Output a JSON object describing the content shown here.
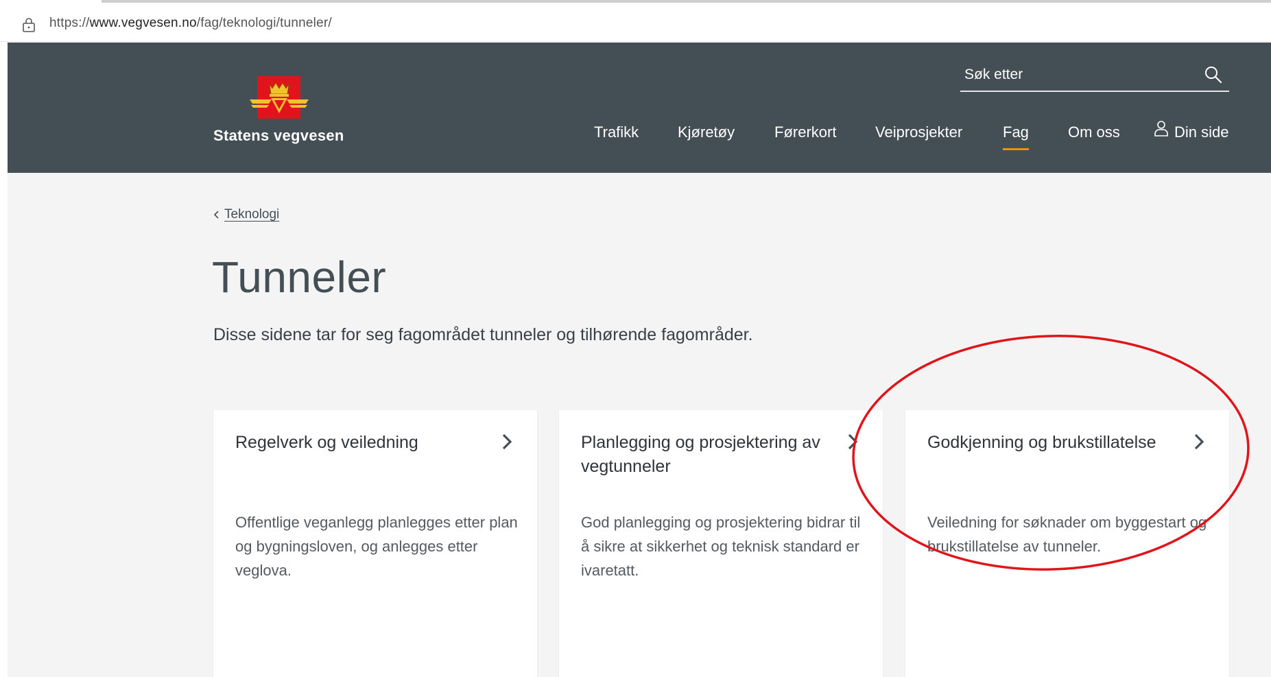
{
  "browser": {
    "url_scheme": "https://",
    "url_host": "www.vegvesen.no",
    "url_path": "/fag/teknologi/tunneler/"
  },
  "header": {
    "brand": "Statens vegvesen",
    "search_placeholder": "Søk etter",
    "nav": [
      {
        "label": "Trafikk"
      },
      {
        "label": "Kjøretøy"
      },
      {
        "label": "Førerkort"
      },
      {
        "label": "Veiprosjekter"
      },
      {
        "label": "Fag",
        "active": true
      },
      {
        "label": "Om oss"
      },
      {
        "label": "Din side",
        "icon": "person-icon"
      }
    ]
  },
  "breadcrumb": {
    "label": "Teknologi"
  },
  "page": {
    "title": "Tunneler",
    "intro": "Disse sidene tar for seg fagområdet tunneler og tilhørende fagområder."
  },
  "cards": [
    {
      "title": "Regelverk og veiledning",
      "text": "Offentlige veganlegg planlegges etter plan og bygningsloven, og anlegges etter veglova."
    },
    {
      "title": "Planlegging og prosjektering av vegtunneler",
      "text": "God planlegging og prosjektering bidrar til å sikre at sikkerhet og teknisk standard er ivaretatt."
    },
    {
      "title": "Godkjenning og brukstillatelse",
      "text": "Veiledning for søknader om byggestart og brukstillatelse av tunneler."
    }
  ],
  "colors": {
    "header_bg": "#444f55",
    "accent": "#ed9300",
    "annotation": "#e0151b"
  }
}
